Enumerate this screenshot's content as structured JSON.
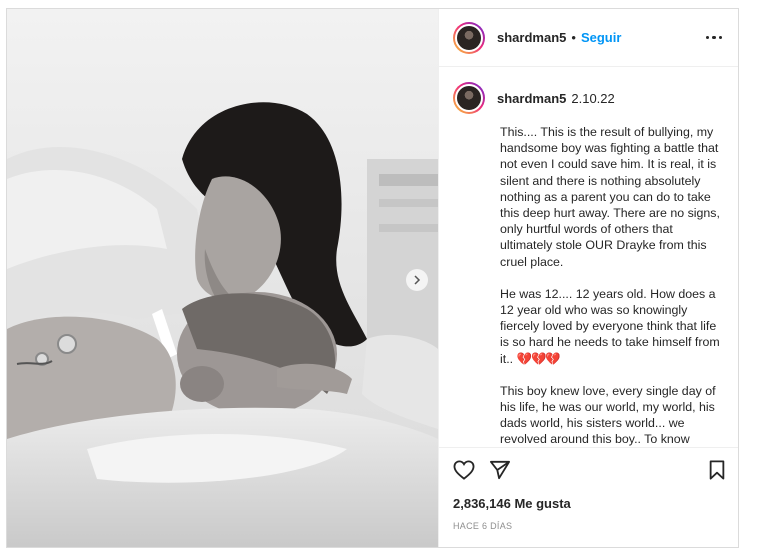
{
  "post": {
    "author": {
      "username": "shardman5",
      "follow_label": "Seguir",
      "separator": "•"
    },
    "caption": {
      "date": "2.10.22",
      "paragraphs": [
        "This.... This is the result of bullying, my handsome boy was fighting a battle that not even I could save him. It is real, it is silent and there is nothing absolutely nothing as a parent you can do to take this deep hurt away. There are no signs, only hurtful words of others that ultimately stole OUR Drayke from this cruel place.",
        "He was 12.... 12 years old. How does a 12 year old who was so knowingly fiercely loved by everyone think that life is so hard he needs to take himself from it..",
        "This boy knew love, every single day of his life, he was our world, my world, his dads world, his sisters world... we revolved around this boy.. To know"
      ],
      "hearts": "💔💔💔"
    },
    "likes_text": "2,836,146 Me gusta",
    "time_ago": "HACE 6 DÍAS"
  },
  "icons": {
    "more": "more-options-icon",
    "like": "heart-icon",
    "share": "send-icon",
    "save": "bookmark-icon",
    "carousel": "chevron-right-icon"
  },
  "colors": {
    "accent": "#0095f6",
    "text": "#262626",
    "muted": "#8e8e8e",
    "border": "#dbdbdb"
  }
}
